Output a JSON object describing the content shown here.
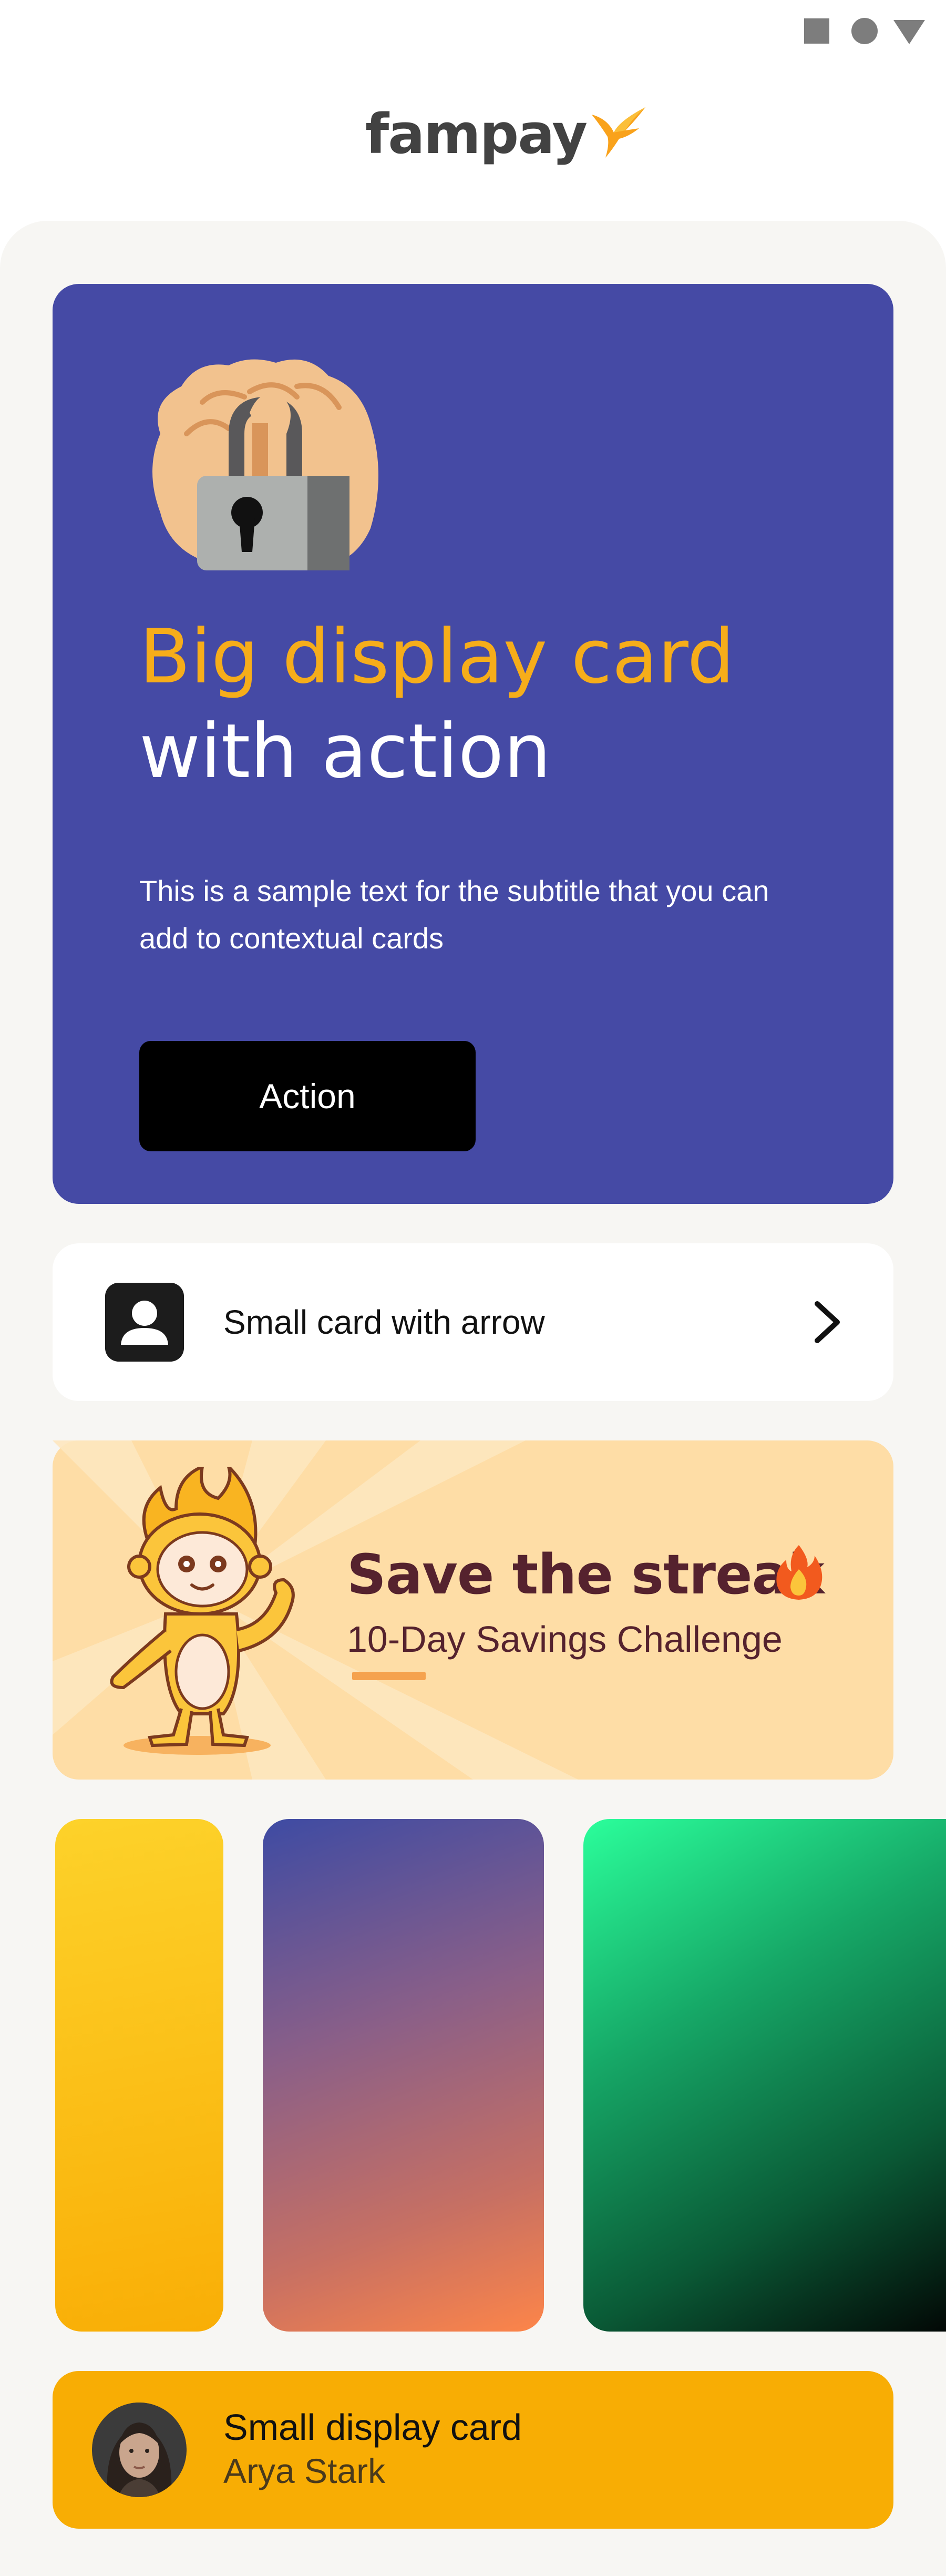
{
  "status_bar": {
    "icons": [
      "square-icon",
      "circle-icon",
      "triangle-icon"
    ],
    "color": "#7d7d7d"
  },
  "header": {
    "brand_name": "fampay",
    "brand_color": "#424242",
    "logo_accent": "#f9a21b"
  },
  "big_card": {
    "background": "#454aa5",
    "image": "lock-hand-icon",
    "title_highlight": "Big display card",
    "title_rest": "with action",
    "subtitle": "This is a sample text for the subtitle that you can add to contextual cards",
    "cta_label": "Action",
    "highlight_color": "#f6ad1a"
  },
  "small_card": {
    "icon": "user-icon",
    "label": "Small card with arrow",
    "trailing_icon": "chevron-right-icon"
  },
  "streak_card": {
    "background": "#fedda6",
    "title": "Save the streak",
    "title_emoji": "flame-icon",
    "subtitle": "10-Day Savings Challenge",
    "text_color": "#55222e",
    "accent": "#f5a24e"
  },
  "gradient_cards": [
    {
      "name": "yellow",
      "from": "#fdd22a",
      "to": "#f9ae06"
    },
    {
      "name": "purple-orange",
      "from": "#3e4ba3",
      "to": "#fd8549"
    },
    {
      "name": "green-black",
      "from": "#2bfe9b",
      "to": "#020403"
    }
  ],
  "display_card": {
    "background": "#f8ad04",
    "title": "Small display card",
    "subtitle": "Arya Stark"
  }
}
